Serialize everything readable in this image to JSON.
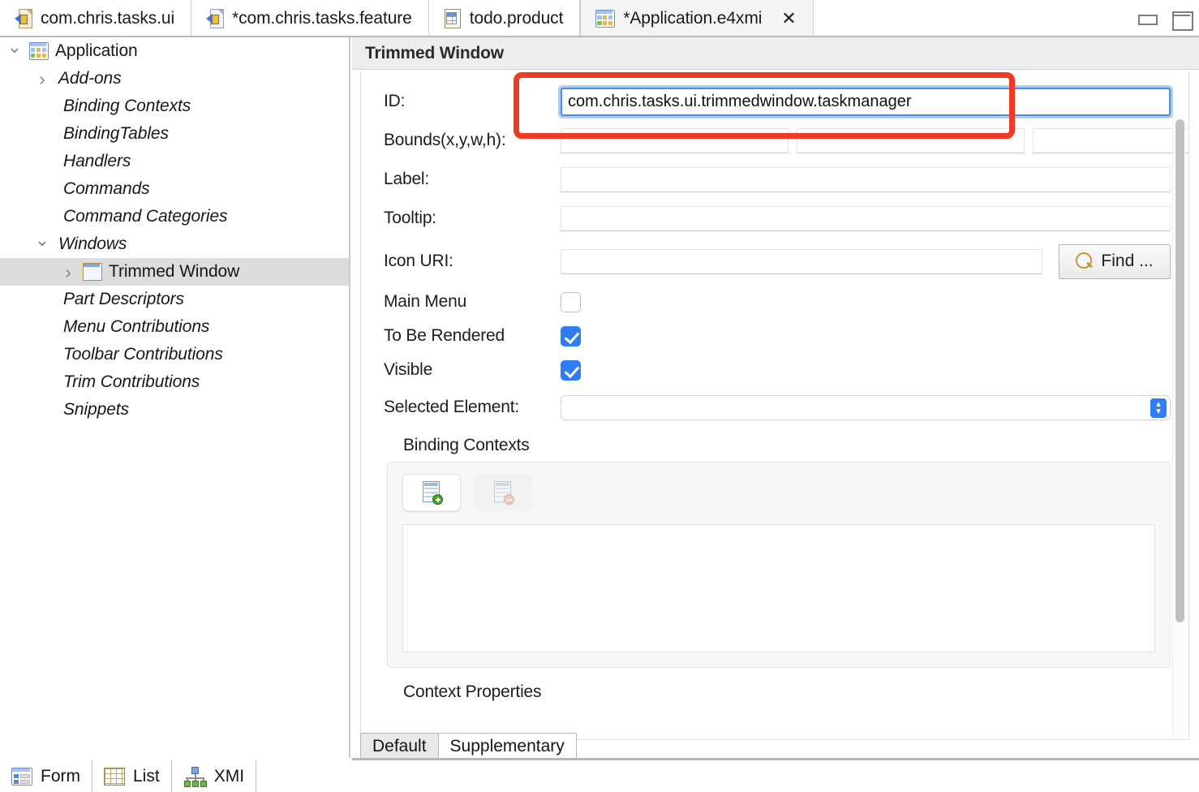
{
  "editor_tabs": [
    {
      "label": "com.chris.tasks.ui",
      "icon": "plugin-icon",
      "active": false,
      "closable": false,
      "dirty": false
    },
    {
      "label": "*com.chris.tasks.feature",
      "icon": "feature-icon",
      "active": false,
      "closable": false,
      "dirty": true
    },
    {
      "label": "todo.product",
      "icon": "product-icon",
      "active": false,
      "closable": false,
      "dirty": false
    },
    {
      "label": "*Application.e4xmi",
      "icon": "application-model-icon",
      "active": true,
      "closable": true,
      "dirty": true,
      "close_glyph": "✕"
    }
  ],
  "view_buttons": [
    {
      "name": "minimize-view-button"
    },
    {
      "name": "maximize-view-button"
    }
  ],
  "tree": {
    "items": [
      {
        "label": "Application",
        "indent": 0,
        "twisty": "down",
        "icon": "application-model-icon",
        "italic": false,
        "selected": false
      },
      {
        "label": "Add-ons",
        "indent": 1,
        "twisty": "right",
        "icon": "none",
        "italic": true,
        "selected": false
      },
      {
        "label": "Binding Contexts",
        "indent": 1,
        "twisty": "none",
        "icon": "none",
        "italic": true,
        "selected": false
      },
      {
        "label": "BindingTables",
        "indent": 1,
        "twisty": "none",
        "icon": "none",
        "italic": true,
        "selected": false
      },
      {
        "label": "Handlers",
        "indent": 1,
        "twisty": "none",
        "icon": "none",
        "italic": true,
        "selected": false
      },
      {
        "label": "Commands",
        "indent": 1,
        "twisty": "none",
        "icon": "none",
        "italic": true,
        "selected": false
      },
      {
        "label": "Command Categories",
        "indent": 1,
        "twisty": "none",
        "icon": "none",
        "italic": true,
        "selected": false
      },
      {
        "label": "Windows",
        "indent": 1,
        "twisty": "down",
        "icon": "none",
        "italic": true,
        "selected": false
      },
      {
        "label": "Trimmed Window",
        "indent": 2,
        "twisty": "right",
        "icon": "trimmed-window-icon",
        "italic": false,
        "selected": true
      },
      {
        "label": "Part Descriptors",
        "indent": 1,
        "twisty": "none",
        "icon": "none",
        "italic": true,
        "selected": false
      },
      {
        "label": "Menu Contributions",
        "indent": 1,
        "twisty": "none",
        "icon": "none",
        "italic": true,
        "selected": false
      },
      {
        "label": "Toolbar Contributions",
        "indent": 1,
        "twisty": "none",
        "icon": "none",
        "italic": true,
        "selected": false
      },
      {
        "label": "Trim Contributions",
        "indent": 1,
        "twisty": "none",
        "icon": "none",
        "italic": true,
        "selected": false
      },
      {
        "label": "Snippets",
        "indent": 1,
        "twisty": "none",
        "icon": "none",
        "italic": true,
        "selected": false
      }
    ]
  },
  "form": {
    "header_title": "Trimmed Window",
    "fields": {
      "id": {
        "label": "ID:",
        "value": "com.chris.tasks.ui.trimmedwindow.taskmanager",
        "placeholder": "",
        "focused": true
      },
      "bounds": {
        "label": "Bounds(x,y,w,h):",
        "values": [
          "",
          "",
          "",
          ""
        ],
        "placeholder": ""
      },
      "label": {
        "label": "Label:",
        "value": "",
        "placeholder": ""
      },
      "tooltip": {
        "label": "Tooltip:",
        "value": "",
        "placeholder": ""
      },
      "icon_uri": {
        "label": "Icon URI:",
        "value": "",
        "placeholder": ""
      },
      "main_menu": {
        "label": "Main Menu",
        "checked": false
      },
      "to_be_rendered": {
        "label": "To Be Rendered",
        "checked": true
      },
      "visible": {
        "label": "Visible",
        "checked": true
      },
      "selected_element": {
        "label": "Selected Element:",
        "value": "",
        "options": []
      }
    },
    "find_button": {
      "label": "Find ...",
      "icon": "magnifier-icon"
    },
    "binding_contexts": {
      "title": "Binding Contexts",
      "add_button": {
        "icon": "add-binding-context-icon",
        "label": ""
      },
      "remove_button": {
        "icon": "remove-binding-context-icon",
        "label": ""
      },
      "items": []
    },
    "context_properties": {
      "title": "Context Properties"
    }
  },
  "section_tabs": [
    {
      "label": "Default",
      "active": true
    },
    {
      "label": "Supplementary",
      "active": false
    }
  ],
  "bottom_tabs": [
    {
      "label": "Form",
      "icon": "form-view-icon",
      "active": true
    },
    {
      "label": "List",
      "icon": "list-view-icon",
      "active": false
    },
    {
      "label": "XMI",
      "icon": "xmi-tree-icon",
      "active": false
    }
  ],
  "annotation": {
    "type": "rectangle-highlight",
    "color": "#ef3b23",
    "target": "id-field"
  },
  "colors": {
    "accent_blue": "#2f7df6",
    "focus_blue": "#4a90e2",
    "annotation_red": "#ef3b23",
    "selection_grey": "#dcdcdc",
    "header_grey": "#ededed"
  }
}
